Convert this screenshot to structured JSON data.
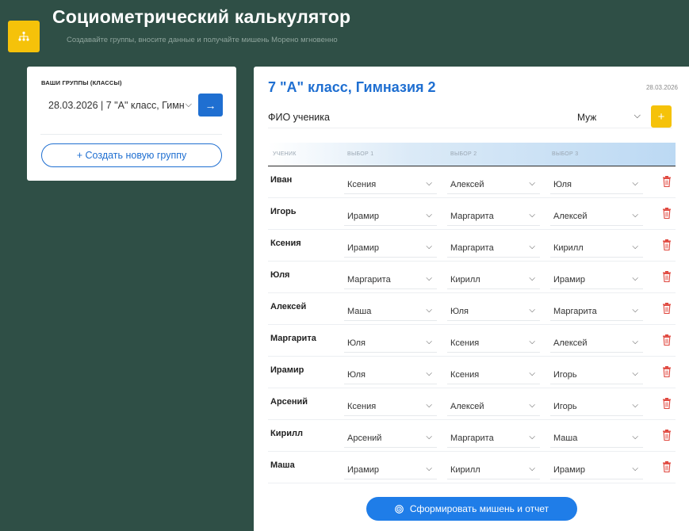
{
  "header": {
    "title": "Социометрический калькулятор",
    "subtitle": "Создавайте группы, вносите данные и получайте мишень Морено мгновенно",
    "logo_icon": "network-icon",
    "accent_color": "#f5c20a"
  },
  "groups_panel": {
    "label": "ВАШИ ГРУППЫ (КЛАССЫ)",
    "selected_group": "28.03.2026 | 7 \"А\" класс, Гимн",
    "go_label": "→",
    "create_label": "+ Создать новую группу"
  },
  "main": {
    "class_title": "7 \"А\" класс, Гимназия 2",
    "date": "28.03.2026",
    "student_placeholder": "ФИО ученика",
    "gender_value": "Муж",
    "add_label": "+",
    "columns": [
      "УЧЕНИК",
      "ВЫБОР 1",
      "ВЫБОР 2",
      "ВЫБОР 3"
    ],
    "rows": [
      {
        "name": "Иван",
        "c1": "Ксения",
        "c2": "Алексей",
        "c3": "Юля"
      },
      {
        "name": "Игорь",
        "c1": "Ирамир",
        "c2": "Маргарита",
        "c3": "Алексей"
      },
      {
        "name": "Ксения",
        "c1": "Ирамир",
        "c2": "Маргарита",
        "c3": "Кирилл"
      },
      {
        "name": "Юля",
        "c1": "Маргарита",
        "c2": "Кирилл",
        "c3": "Ирамир"
      },
      {
        "name": "Алексей",
        "c1": "Маша",
        "c2": "Юля",
        "c3": "Маргарита"
      },
      {
        "name": "Маргарита",
        "c1": "Юля",
        "c2": "Ксения",
        "c3": "Алексей"
      },
      {
        "name": "Ирамир",
        "c1": "Юля",
        "c2": "Ксения",
        "c3": "Игорь"
      },
      {
        "name": "Арсений",
        "c1": "Ксения",
        "c2": "Алексей",
        "c3": "Игорь"
      },
      {
        "name": "Кирилл",
        "c1": "Арсений",
        "c2": "Маргарита",
        "c3": "Маша"
      },
      {
        "name": "Маша",
        "c1": "Ирамир",
        "c2": "Кирилл",
        "c3": "Ирамир"
      }
    ],
    "generate_label": "Сформировать мишень и отчет",
    "delete_color": "#e0473e"
  }
}
